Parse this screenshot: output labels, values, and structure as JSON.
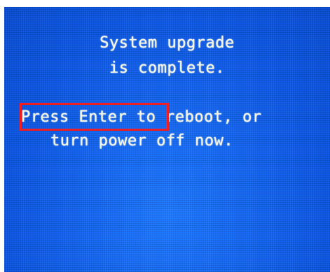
{
  "screen": {
    "line1": "System upgrade",
    "line2": "is complete.",
    "line3_action": "Press Enter",
    "line3_rest": " to reboot, or",
    "line4": "turn power off now."
  },
  "colors": {
    "background": "#1566f0",
    "text": "#f4f7e6",
    "highlight": "#ee1f24"
  }
}
